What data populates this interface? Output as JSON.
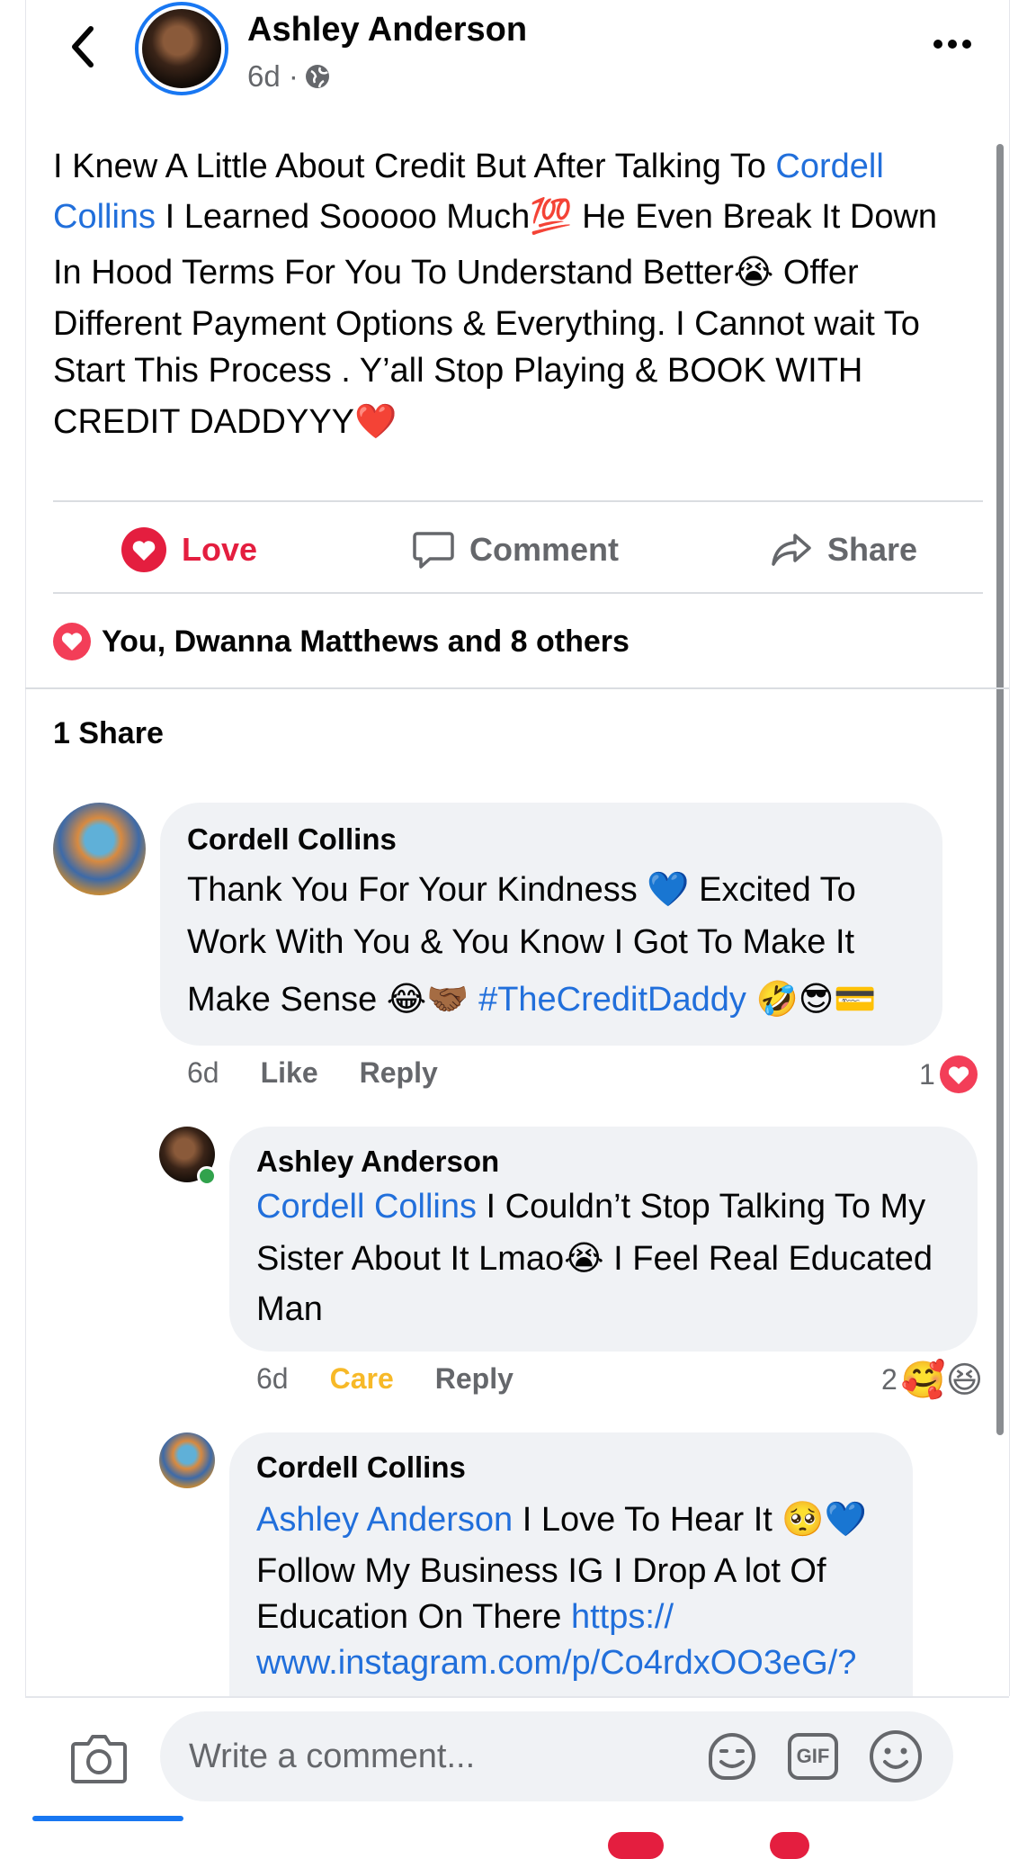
{
  "post": {
    "author": "Ashley Anderson",
    "time": "6d ·",
    "text": {
      "part1": "I Knew A Little About Credit But After Talking To ",
      "mention": "Cordell",
      "mention2": "Collins",
      "part2": " I Learned Sooooo Much💯 He Even Break It Down",
      "line3": "In Hood Terms For You To Understand Better😭 Offer",
      "line4": "Different Payment Options & Everything. I Cannot wait To",
      "line5": "Start This Process . Y’all Stop Playing & BOOK WITH",
      "line6": "CREDIT DADDYYY❤️"
    }
  },
  "actions": {
    "love": "Love",
    "comment": "Comment",
    "share": "Share"
  },
  "reactions_summary": "You, Dwanna Matthews and 8 others",
  "shares_count": "1 Share",
  "comments": [
    {
      "name": "Cordell Collins",
      "line1": "Thank You For Your Kindness 💙 Excited To",
      "line2": "Work With You & You Know I Got To Make It",
      "line3a": "Make Sense 😂🤝🏾 ",
      "hashtag": "#TheCreditDaddy",
      "line3b": " 🤣😎💳",
      "time": "6d",
      "like": "Like",
      "reply": "Reply",
      "reaction_count": "1"
    },
    {
      "name": "Ashley Anderson",
      "mention": "Cordell Collins",
      "line1": " I Couldn’t Stop Talking To My",
      "line2": "Sister About It Lmao😭 I Feel Real Educated",
      "line3": "Man",
      "time": "6d",
      "care": "Care",
      "reply": "Reply",
      "reaction_count": "2",
      "reaction_emojis": "🥰😆"
    },
    {
      "name": "Cordell Collins",
      "mention": "Ashley Anderson",
      "line1": " I Love To Hear It 🥺💙",
      "line2": "Follow My Business IG I Drop A lot Of",
      "line3": "Education On There ",
      "link1": "https://",
      "link2": "www.instagram.com/p/Co4rdxOO3eG/?"
    }
  ],
  "composer": {
    "placeholder": "Write a comment...",
    "gif_label": "GIF"
  },
  "colors": {
    "accent": "#1877f2",
    "love": "#e41e3f",
    "link": "#216fdb",
    "care": "#f7b928"
  }
}
